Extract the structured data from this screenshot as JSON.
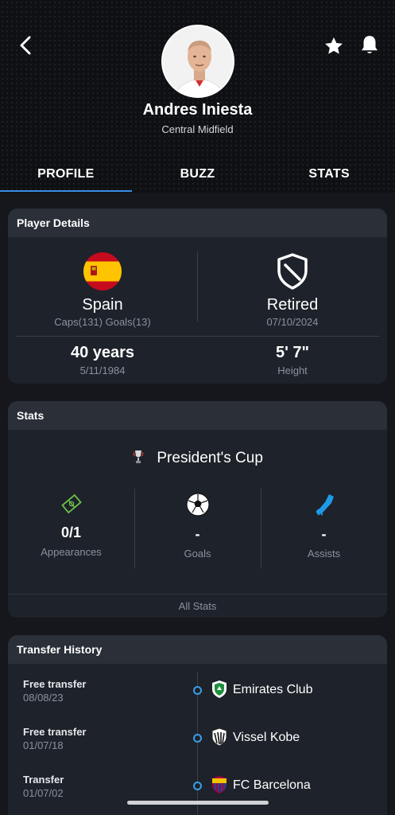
{
  "header": {
    "player_name": "Andres Iniesta",
    "position": "Central Midfield",
    "icons": {
      "back": "back-chevron-icon",
      "favorite": "star-icon",
      "notify": "bell-icon"
    }
  },
  "tabs": [
    {
      "label": "PROFILE",
      "active": true
    },
    {
      "label": "BUZZ",
      "active": false
    },
    {
      "label": "STATS",
      "active": false
    }
  ],
  "details": {
    "title": "Player Details",
    "country": "Spain",
    "country_sub": "Caps(131) Goals(13)",
    "status": "Retired",
    "status_date": "07/10/2024",
    "age": "40 years",
    "dob": "5/11/1984",
    "height": "5' 7\"",
    "height_label": "Height"
  },
  "stats": {
    "title": "Stats",
    "competition": "President's Cup",
    "appearances": "0/1",
    "appearances_label": "Appearances",
    "goals": "-",
    "goals_label": "Goals",
    "assists": "-",
    "assists_label": "Assists",
    "all_stats": "All Stats"
  },
  "transfers": {
    "title": "Transfer History",
    "items": [
      {
        "type": "Free transfer",
        "date": "08/08/23",
        "club": "Emirates Club"
      },
      {
        "type": "Free transfer",
        "date": "01/07/18",
        "club": "Vissel Kobe"
      },
      {
        "type": "Transfer",
        "date": "01/07/02",
        "club": "FC Barcelona"
      }
    ]
  },
  "colors": {
    "accent": "#3a8ee6",
    "background": "#15171c",
    "card": "#1e222a",
    "pitch_icon": "#6cc24a",
    "boot_icon": "#1e9be8"
  }
}
